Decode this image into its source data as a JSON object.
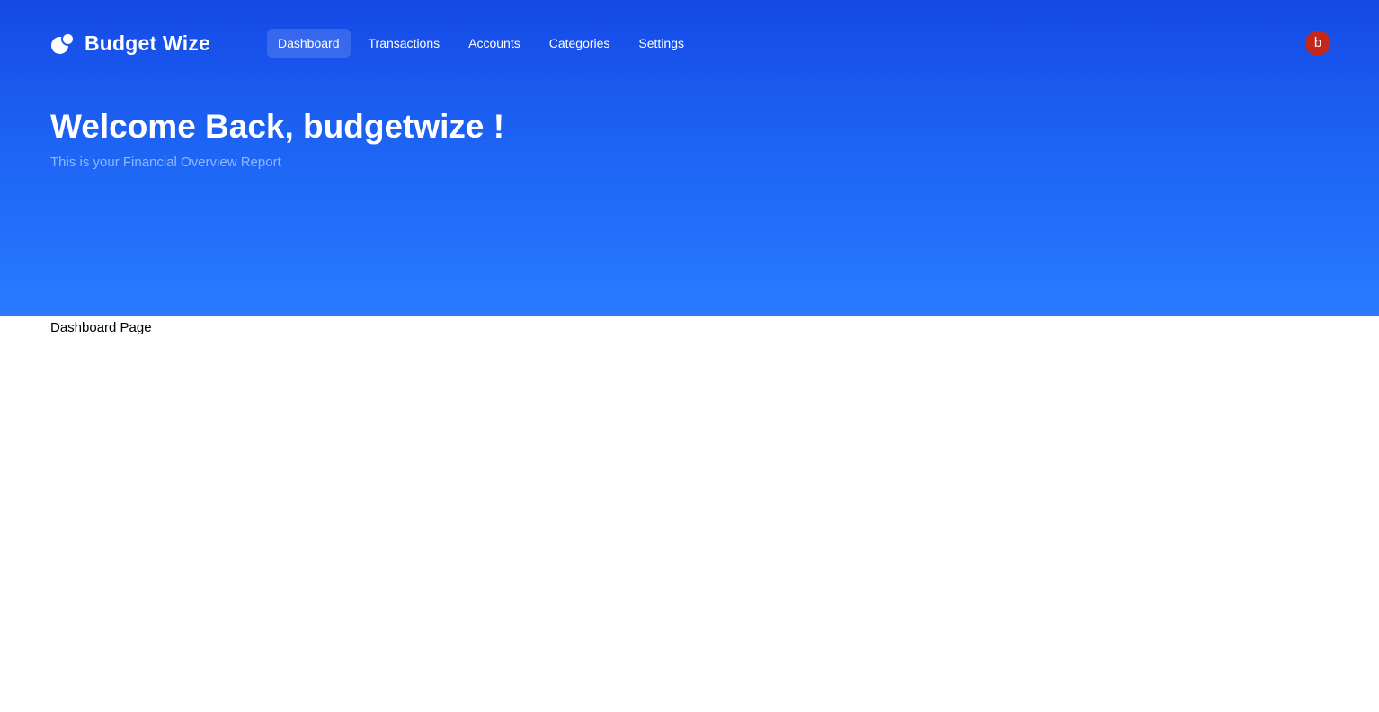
{
  "brand": {
    "name": "Budget Wize",
    "icon": "budget-wize-logo-icon"
  },
  "nav": {
    "items": [
      {
        "label": "Dashboard",
        "active": true
      },
      {
        "label": "Transactions",
        "active": false
      },
      {
        "label": "Accounts",
        "active": false
      },
      {
        "label": "Categories",
        "active": false
      },
      {
        "label": "Settings",
        "active": false
      }
    ]
  },
  "user": {
    "avatar_initial": "b",
    "avatar_color": "#c2291c"
  },
  "hero": {
    "welcome": "Welcome Back, budgetwize !",
    "subtitle": "This is your Financial Overview Report",
    "gradient": [
      "#1549e6",
      "#2b7bff"
    ]
  },
  "main": {
    "page_label": "Dashboard Page"
  }
}
